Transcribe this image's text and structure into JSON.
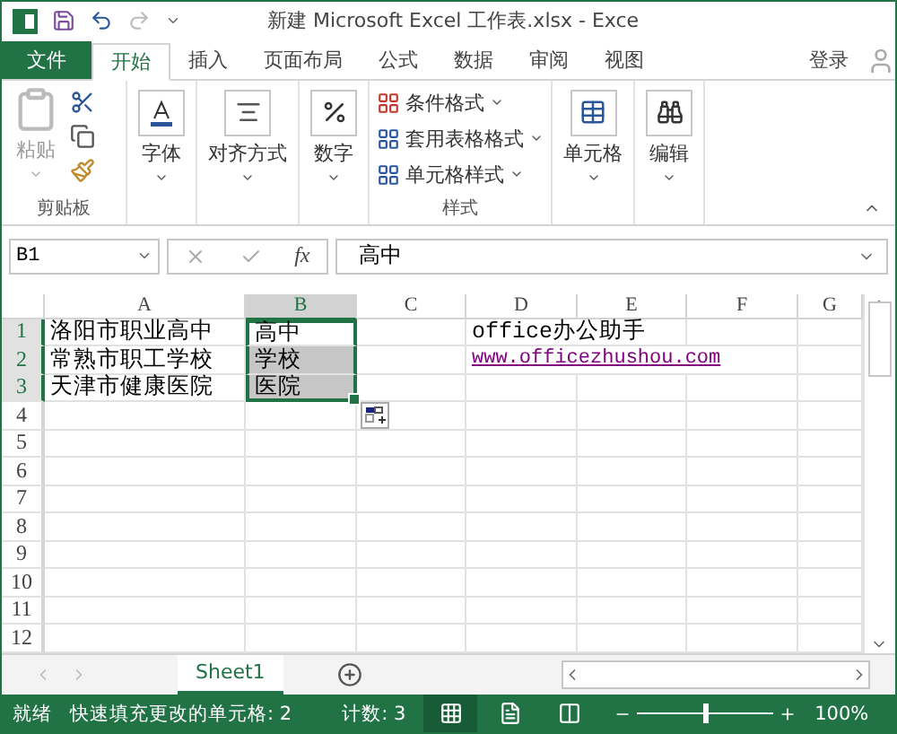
{
  "title_bar": {
    "title": "新建 Microsoft Excel 工作表.xlsx - Exce"
  },
  "ribbon_tabs": [
    {
      "label": "文件",
      "kind": "file",
      "selected": false
    },
    {
      "label": "开始",
      "kind": "tab",
      "selected": true
    },
    {
      "label": "插入",
      "kind": "tab",
      "selected": false
    },
    {
      "label": "页面布局",
      "kind": "tab",
      "selected": false
    },
    {
      "label": "公式",
      "kind": "tab",
      "selected": false
    },
    {
      "label": "数据",
      "kind": "tab",
      "selected": false
    },
    {
      "label": "审阅",
      "kind": "tab",
      "selected": false
    },
    {
      "label": "视图",
      "kind": "tab",
      "selected": false
    },
    {
      "label": "登录",
      "kind": "signin",
      "selected": false
    }
  ],
  "ribbon_groups": [
    {
      "kind": "clipboard",
      "label": "剪贴板",
      "button": "粘贴"
    },
    {
      "kind": "big",
      "button": "字体"
    },
    {
      "kind": "big",
      "button": "对齐方式"
    },
    {
      "kind": "big",
      "button": "数字"
    },
    {
      "kind": "styles",
      "label": "样式",
      "items": [
        "条件格式",
        "套用表格格式",
        "单元格样式"
      ]
    },
    {
      "kind": "big",
      "button": "单元格"
    },
    {
      "kind": "big",
      "button": "编辑"
    }
  ],
  "formula_bar": {
    "name_box": "B1",
    "fx": "fx",
    "formula": "高中"
  },
  "columns": [
    {
      "label": "A",
      "selected": false
    },
    {
      "label": "B",
      "selected": true
    },
    {
      "label": "C",
      "selected": false
    },
    {
      "label": "D",
      "selected": false
    },
    {
      "label": "E",
      "selected": false
    },
    {
      "label": "F",
      "selected": false
    },
    {
      "label": "G",
      "selected": false
    }
  ],
  "rows": [
    {
      "number": "1",
      "selected": true,
      "cells": [
        {
          "text": "洛阳市职业高中"
        },
        {
          "text": "高中",
          "selected": true
        },
        {},
        {
          "text": "office办公助手"
        }
      ]
    },
    {
      "number": "2",
      "selected": true,
      "cells": [
        {
          "text": "常熟市职工学校"
        },
        {
          "text": "学校",
          "selected": true,
          "changed": true
        },
        {},
        {
          "text": "www.officezhushou.com",
          "kind": "link"
        }
      ]
    },
    {
      "number": "3",
      "selected": true,
      "cells": [
        {
          "text": "天津市健康医院"
        },
        {
          "text": "医院",
          "selected": true,
          "changed": true
        }
      ]
    },
    {
      "number": "4",
      "selected": false
    },
    {
      "number": "5",
      "selected": false
    },
    {
      "number": "6",
      "selected": false
    },
    {
      "number": "7",
      "selected": false
    },
    {
      "number": "8",
      "selected": false
    },
    {
      "number": "9",
      "selected": false
    },
    {
      "number": "10",
      "selected": false
    },
    {
      "number": "11",
      "selected": false
    },
    {
      "number": "12",
      "selected": false
    }
  ],
  "sheets": [
    {
      "label": "Sheet1",
      "selected": true
    }
  ],
  "status_bar": {
    "ready": "就绪",
    "flash_fill": "快速填充更改的单元格: 2",
    "count": "计数: 3",
    "views": [
      {
        "selected": true
      },
      {
        "selected": false
      },
      {
        "selected": false
      }
    ],
    "zoom": {
      "label": "100%",
      "level": 0.5
    }
  }
}
